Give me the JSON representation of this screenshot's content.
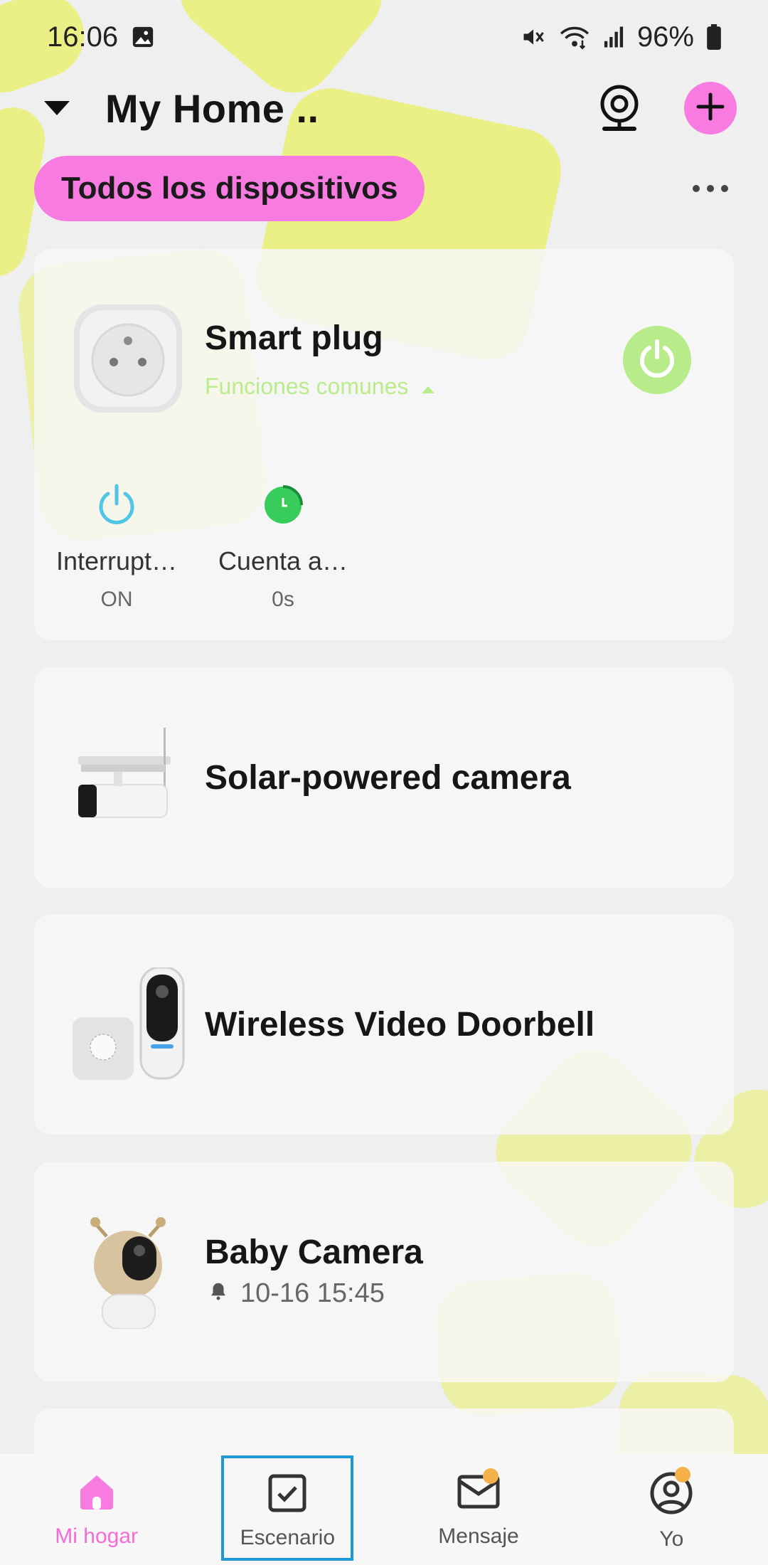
{
  "status_bar": {
    "time": "16:06",
    "battery": "96%",
    "icons": [
      "gallery-icon",
      "mute-icon",
      "wifi-icon",
      "signal-icon",
      "battery-icon"
    ]
  },
  "header": {
    "title": "My Home ..",
    "icons": [
      "chevron-down-icon",
      "camera-icon",
      "plus-icon"
    ]
  },
  "filter": {
    "label": "Todos los dispositivos",
    "more_icon": "more-icon"
  },
  "devices": [
    {
      "name": "Smart plug",
      "link": "Funciones comunes",
      "power_icon": "power-icon",
      "functions": [
        {
          "label": "Interrupt…",
          "value": "ON",
          "icon": "power-icon"
        },
        {
          "label": "Cuenta a…",
          "value": "0s",
          "icon": "timer-icon"
        }
      ]
    },
    {
      "name": "Solar-powered camera"
    },
    {
      "name": "Wireless Video Doorbell"
    },
    {
      "name": "Baby Camera",
      "alert_time": "10-16 15:45",
      "alert_icon": "bell-icon"
    }
  ],
  "tabs": [
    {
      "label": "Mi hogar",
      "icon": "home-icon",
      "active": true
    },
    {
      "label": "Escenario",
      "icon": "checkbox-icon",
      "active": false
    },
    {
      "label": "Mensaje",
      "icon": "mail-icon",
      "active": false,
      "badge": true
    },
    {
      "label": "Yo",
      "icon": "user-icon",
      "active": false,
      "badge": true
    }
  ],
  "colors": {
    "accent_pink": "#f77be0",
    "accent_green": "#b8ec8a",
    "lime_decoration": "#e9f06a",
    "focus_outline": "#1e9ad6"
  }
}
